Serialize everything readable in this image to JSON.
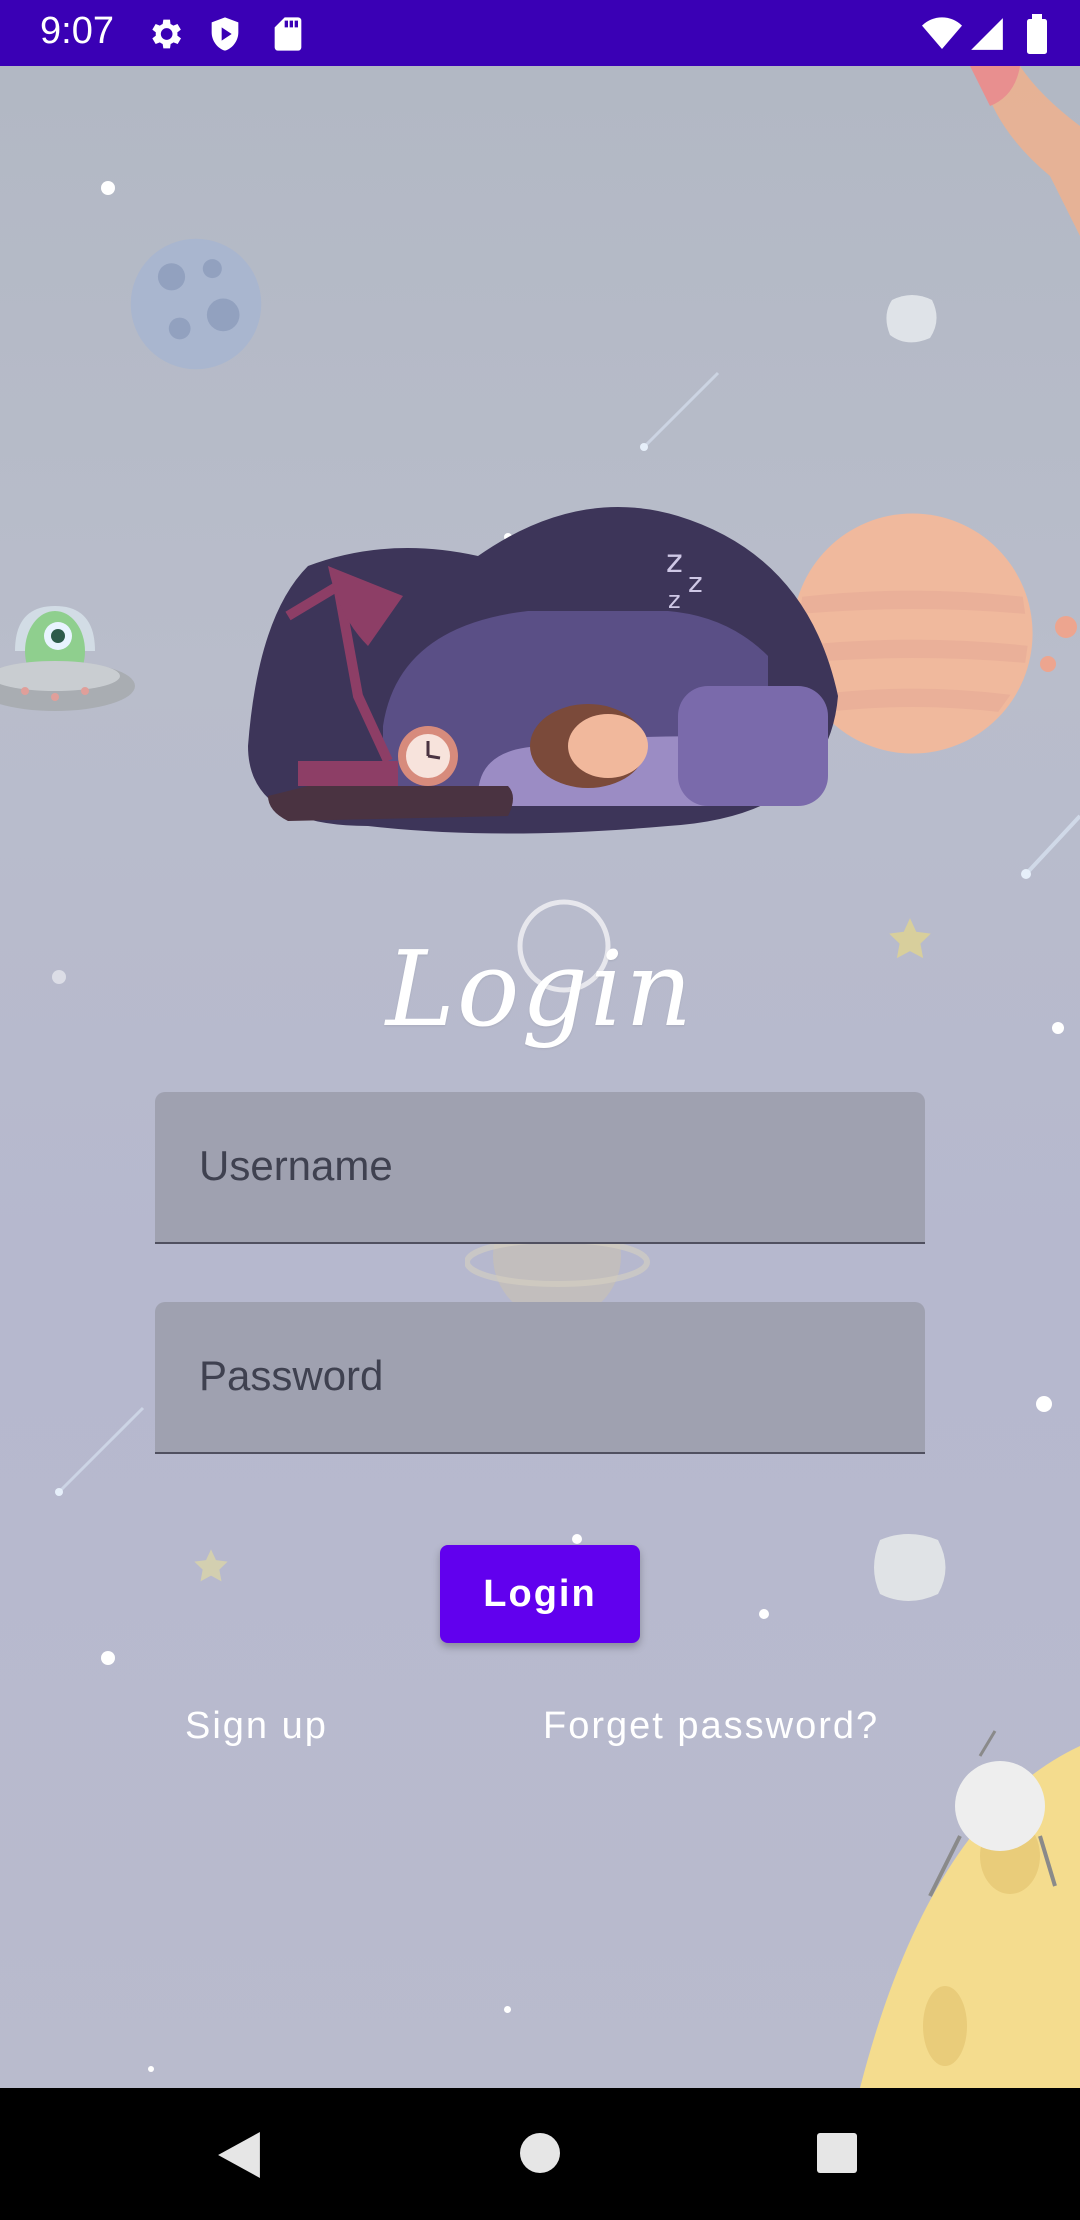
{
  "status_bar": {
    "time": "9:07",
    "icons": [
      "gear-icon",
      "play-protect-icon",
      "sd-card-icon"
    ],
    "right_icons": [
      "wifi-icon",
      "signal-icon",
      "battery-icon"
    ]
  },
  "screen": {
    "title": "Login",
    "username": {
      "placeholder": "Username",
      "value": ""
    },
    "password": {
      "placeholder": "Password",
      "value": ""
    },
    "login_button": "Login",
    "signup_link": "Sign up",
    "forgot_link": "Forget password?"
  },
  "colors": {
    "status_bar": "#3a00b5",
    "accent": "#6100ee",
    "field": "#9fa1b0",
    "background": "#b7bccb"
  },
  "nav_bar": {
    "icons": [
      "back-icon",
      "home-icon",
      "recents-icon"
    ]
  }
}
